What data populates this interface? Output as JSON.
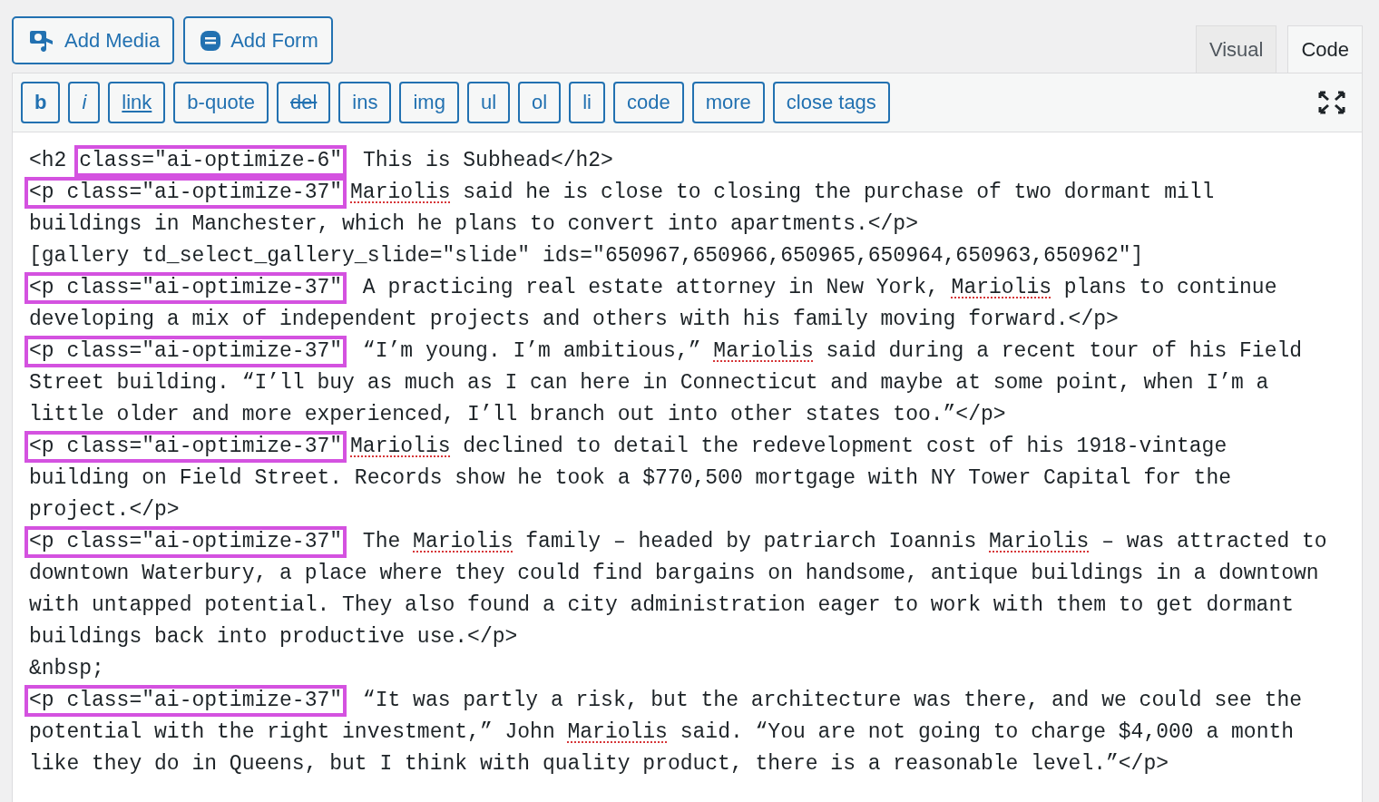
{
  "media_buttons": [
    {
      "label": "Add Media",
      "kind": "media"
    },
    {
      "label": "Add Form",
      "kind": "form"
    }
  ],
  "tabs": [
    {
      "label": "Visual",
      "selected": false
    },
    {
      "label": "Code",
      "selected": true
    }
  ],
  "toolbar": [
    {
      "label": "b",
      "kind": "bold"
    },
    {
      "label": "i",
      "kind": "italic"
    },
    {
      "label": "link",
      "kind": "underline"
    },
    {
      "label": "b-quote",
      "kind": "plain"
    },
    {
      "label": "del",
      "kind": "strike"
    },
    {
      "label": "ins",
      "kind": "plain"
    },
    {
      "label": "img",
      "kind": "plain"
    },
    {
      "label": "ul",
      "kind": "plain"
    },
    {
      "label": "ol",
      "kind": "plain"
    },
    {
      "label": "li",
      "kind": "plain"
    },
    {
      "label": "code",
      "kind": "plain"
    },
    {
      "label": "more",
      "kind": "plain"
    },
    {
      "label": "close tags",
      "kind": "plain"
    }
  ],
  "code_lines": [
    [
      {
        "text": "<h2 ",
        "kind": "plain"
      },
      {
        "text": "class=\"ai-optimize-6\"",
        "kind": "highlight"
      },
      {
        "text": " This is Subhead</h2>",
        "kind": "plain"
      }
    ],
    [
      {
        "text": "<p class=\"ai-optimize-37\"",
        "kind": "highlight"
      },
      {
        "text": "Mariolis",
        "kind": "misspelled"
      },
      {
        "text": " said he is close to closing the purchase of two dormant mill",
        "kind": "plain"
      }
    ],
    [
      {
        "text": "buildings in Manchester, which he plans to convert into apartments.</p>",
        "kind": "plain"
      }
    ],
    [
      {
        "text": "[gallery td_select_gallery_slide=\"slide\" ids=\"650967,650966,650965,650964,650963,650962\"]",
        "kind": "plain"
      }
    ],
    [
      {
        "text": "<p class=\"ai-optimize-37\"",
        "kind": "highlight"
      },
      {
        "text": " A practicing real estate attorney in New York, ",
        "kind": "plain"
      },
      {
        "text": "Mariolis",
        "kind": "misspelled"
      },
      {
        "text": " plans to continue",
        "kind": "plain"
      }
    ],
    [
      {
        "text": "developing a mix of independent projects and others with his family moving forward.</p>",
        "kind": "plain"
      }
    ],
    [
      {
        "text": "<p class=\"ai-optimize-37\"",
        "kind": "highlight"
      },
      {
        "text": " “I’m young. I’m ambitious,” ",
        "kind": "plain"
      },
      {
        "text": "Mariolis",
        "kind": "misspelled"
      },
      {
        "text": " said during a recent tour of his Field",
        "kind": "plain"
      }
    ],
    [
      {
        "text": "Street building. “I’ll buy as much as I can here in Connecticut and maybe at some point, when I’m a",
        "kind": "plain"
      }
    ],
    [
      {
        "text": "little older and more experienced, I’ll branch out into other states too.”</p>",
        "kind": "plain"
      }
    ],
    [
      {
        "text": "<p class=\"ai-optimize-37\"",
        "kind": "highlight"
      },
      {
        "text": "Mariolis",
        "kind": "misspelled"
      },
      {
        "text": " declined to detail the redevelopment cost of his 1918-vintage",
        "kind": "plain"
      }
    ],
    [
      {
        "text": "building on Field Street. Records show he took a $770,500 mortgage with NY Tower Capital for the",
        "kind": "plain"
      }
    ],
    [
      {
        "text": "project.</p>",
        "kind": "plain"
      }
    ],
    [
      {
        "text": "<p class=\"ai-optimize-37\"",
        "kind": "highlight"
      },
      {
        "text": " The ",
        "kind": "plain"
      },
      {
        "text": "Mariolis",
        "kind": "misspelled"
      },
      {
        "text": " family – headed by patriarch Ioannis ",
        "kind": "plain"
      },
      {
        "text": "Mariolis",
        "kind": "misspelled"
      },
      {
        "text": " – was attracted to",
        "kind": "plain"
      }
    ],
    [
      {
        "text": "downtown Waterbury, a place where they could find bargains on handsome, antique buildings in a downtown",
        "kind": "plain"
      }
    ],
    [
      {
        "text": "with untapped potential. They also found a city administration eager to work with them to get dormant",
        "kind": "plain"
      }
    ],
    [
      {
        "text": "buildings back into productive use.</p>",
        "kind": "plain"
      }
    ],
    [
      {
        "text": "&nbsp;",
        "kind": "plain"
      }
    ],
    [
      {
        "text": "<p class=\"ai-optimize-37\"",
        "kind": "highlight"
      },
      {
        "text": " “It was partly a risk, but the architecture was there, and we could see the",
        "kind": "plain"
      }
    ],
    [
      {
        "text": "potential with the right investment,” John ",
        "kind": "plain"
      },
      {
        "text": "Mariolis",
        "kind": "misspelled"
      },
      {
        "text": " said. “You are not going to charge $4,000 a month",
        "kind": "plain"
      }
    ],
    [
      {
        "text": "like they do in Queens, but I think with quality product, there is a reasonable level.”</p>",
        "kind": "plain"
      }
    ]
  ]
}
